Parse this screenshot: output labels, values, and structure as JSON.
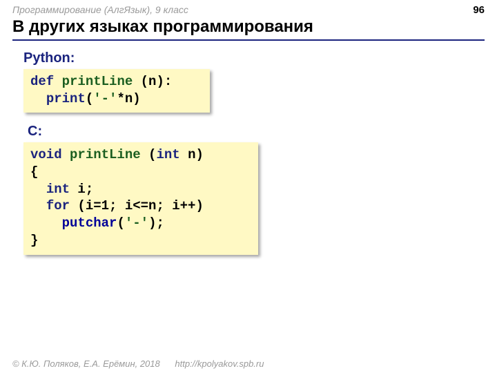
{
  "header": {
    "subject": "Программирование (АлгЯзык), 9 класс",
    "page_number": "96"
  },
  "title": "В других языках программирования",
  "sections": {
    "python": {
      "label": "Python:",
      "code": {
        "def": "def",
        "fn": "printLine",
        "params": "(n):",
        "indent": "  ",
        "call": "print",
        "open": "(",
        "str": "'-'",
        "rest": "*n)"
      }
    },
    "c": {
      "label": "С:",
      "code": {
        "void": "void",
        "fn": "printLine",
        "params_open": "(",
        "int_kw": "int",
        "params_rest": " n)",
        "lbrace": "{",
        "indent": "  ",
        "decl_kw": "int",
        "decl_rest": " i;",
        "for_kw": "for",
        "for_rest": " (i=1; i<=n; i++)",
        "put": "putchar",
        "put_open": "(",
        "put_str": "'-'",
        "put_close": ");",
        "rbrace": "}"
      }
    }
  },
  "footer": {
    "copyright": "© К.Ю. Поляков, Е.А. Ерёмин, 2018",
    "url": "http://kpolyakov.spb.ru"
  }
}
